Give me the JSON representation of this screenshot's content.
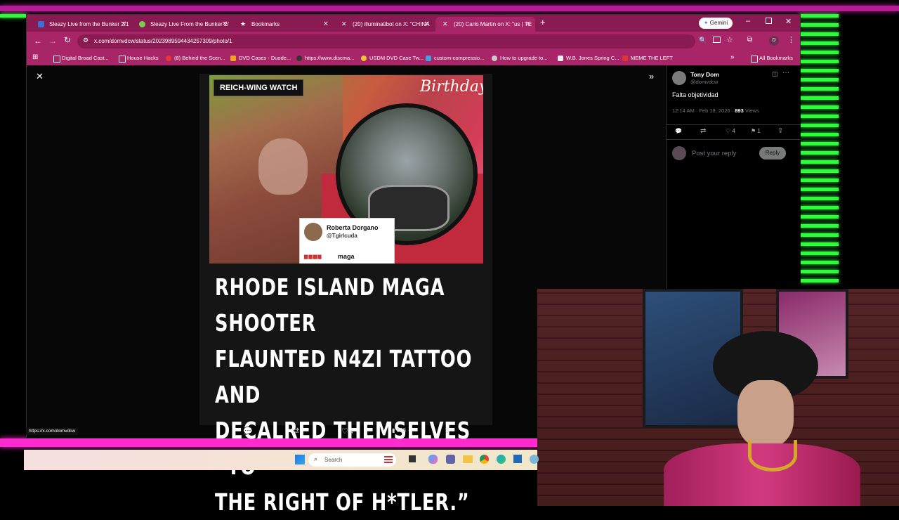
{
  "browser": {
    "tabs": [
      {
        "title": "Sleazy Live from the Bunker 2/1",
        "active": false
      },
      {
        "title": "Sleazy Live From the Bunker 2/",
        "active": false
      },
      {
        "title": "Bookmarks",
        "active": false
      },
      {
        "title": "(20) illuminatibot on X: \"CHINA",
        "active": false
      },
      {
        "title": "(20) Carlo Martin on X: \"us | TE",
        "active": true
      }
    ],
    "gemini_label": "Gemini",
    "url": "x.com/domvdcw/status/2023989594434257309/photo/1",
    "profile_letter": "D",
    "bookmarks": [
      "Digital Broad Cast...",
      "House Hacks",
      "(8) Behind the Scen...",
      "DVD Cases - Duode...",
      "https://www.discma...",
      "USDM DVD Case Tw...",
      "custom-compressio...",
      "How to upgrade to...",
      "W.B. Jones Spring C...",
      "MEME THE LEFT"
    ],
    "all_bookmarks": "All Bookmarks",
    "status_url": "https://x.com/domvdcw"
  },
  "tweet_image": {
    "badge": "REICH-WING WATCH",
    "birthday_text": "Birthday",
    "quote_name": "Roberta Dorgano",
    "quote_handle": "@Tgirlcuda",
    "quote_tag": "maga",
    "headline_lines": [
      "RHODE ISLAND MAGA SHOOTER",
      "FLAUNTED N4ZI TATTOO AND",
      "DECALRED THEMSELVES “TO",
      "THE RIGHT OF H*TLER.”"
    ]
  },
  "actions": {
    "likes": "4",
    "views": "893"
  },
  "side": {
    "name": "Tony Dom",
    "handle": "@domvdcw",
    "text": "Falta objetividad",
    "time": "12:14 AM · Feb 18, 2026 ·",
    "views_count": "893",
    "views_label": "Views",
    "likes": "4",
    "bookmarks": "1",
    "reply_placeholder": "Post your reply",
    "reply_button": "Reply"
  },
  "taskbar": {
    "search_label": "Search"
  },
  "colors": {
    "tab_bar": "#8a1a52",
    "toolbar": "#a82567",
    "neon_green": "#2cff3a",
    "neon_pink": "#ff2ad0"
  }
}
